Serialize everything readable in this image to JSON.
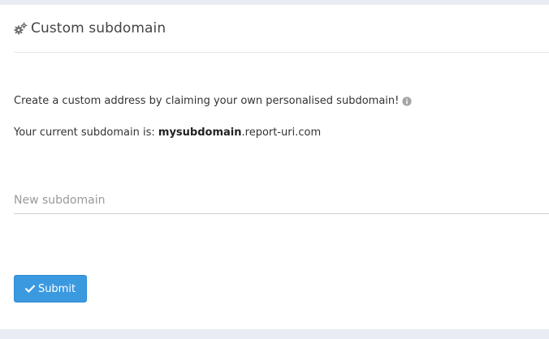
{
  "header": {
    "title": "Custom subdomain",
    "icon": "cogs-icon"
  },
  "intro": {
    "text": "Create a custom address by claiming your own personalised subdomain!",
    "info_icon": "info-circle-icon"
  },
  "current": {
    "prefix": "Your current subdomain is: ",
    "subdomain": "mysubdomain",
    "suffix": ".report-uri.com"
  },
  "form": {
    "placeholder": "New subdomain",
    "value": "",
    "submit_label": "Submit",
    "submit_icon": "check-icon"
  },
  "colors": {
    "accent": "#3b99e0",
    "background": "#e9ecf3",
    "panel": "#ffffff"
  }
}
